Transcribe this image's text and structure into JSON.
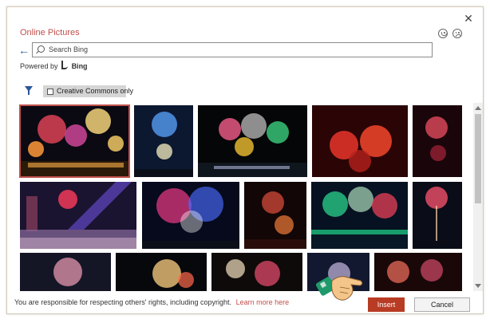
{
  "dialog": {
    "title": "Online Pictures",
    "close_icon": "close-icon",
    "feedback_icons": [
      "smile-icon",
      "frown-icon"
    ]
  },
  "search": {
    "back_icon": "back-arrow-icon",
    "placeholder": "Search Bing",
    "value": "",
    "powered_by": "Powered by",
    "provider": "Bing"
  },
  "filters": {
    "filter_icon": "filter-icon",
    "creative_commons_label": "Creative Commons only",
    "creative_commons_checked": false
  },
  "results": {
    "subject": "fireworks",
    "selected_index": 0,
    "count_visible": 17
  },
  "footer": {
    "disclaimer": "You are responsible for respecting others' rights, including copyright.",
    "learn_more": "Learn more here",
    "insert_label": "Insert",
    "cancel_label": "Cancel"
  },
  "colors": {
    "accent": "#c0504d",
    "insert_button": "#b83b24",
    "link": "#2b579a"
  },
  "overlay": {
    "pointer": "pointing-hand-icon"
  }
}
